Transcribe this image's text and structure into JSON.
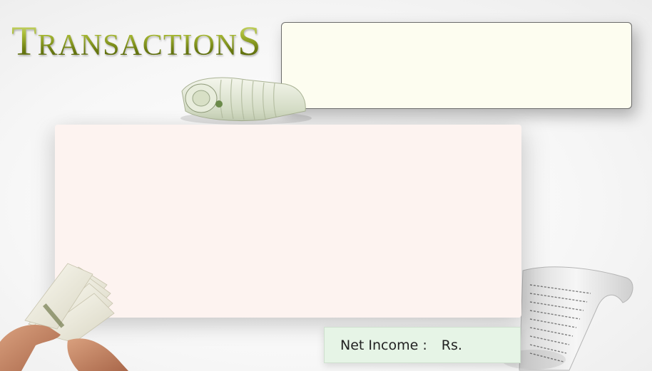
{
  "header": {
    "title": "TRANSACTIONS",
    "title_letters": [
      "T",
      "RANSACTION",
      "S"
    ]
  },
  "footer": {
    "net_income_label": "Net Income :",
    "currency_label": "Rs."
  },
  "colors": {
    "title_green": "#7c8b1e",
    "info_panel_bg": "#fdfdf0",
    "main_panel_bg": "#fdf3f0",
    "net_income_bg": "#e6f4e6"
  },
  "icons": [
    "money-roll-icon",
    "book-in-hands-icon",
    "receipt-roll-icon"
  ]
}
